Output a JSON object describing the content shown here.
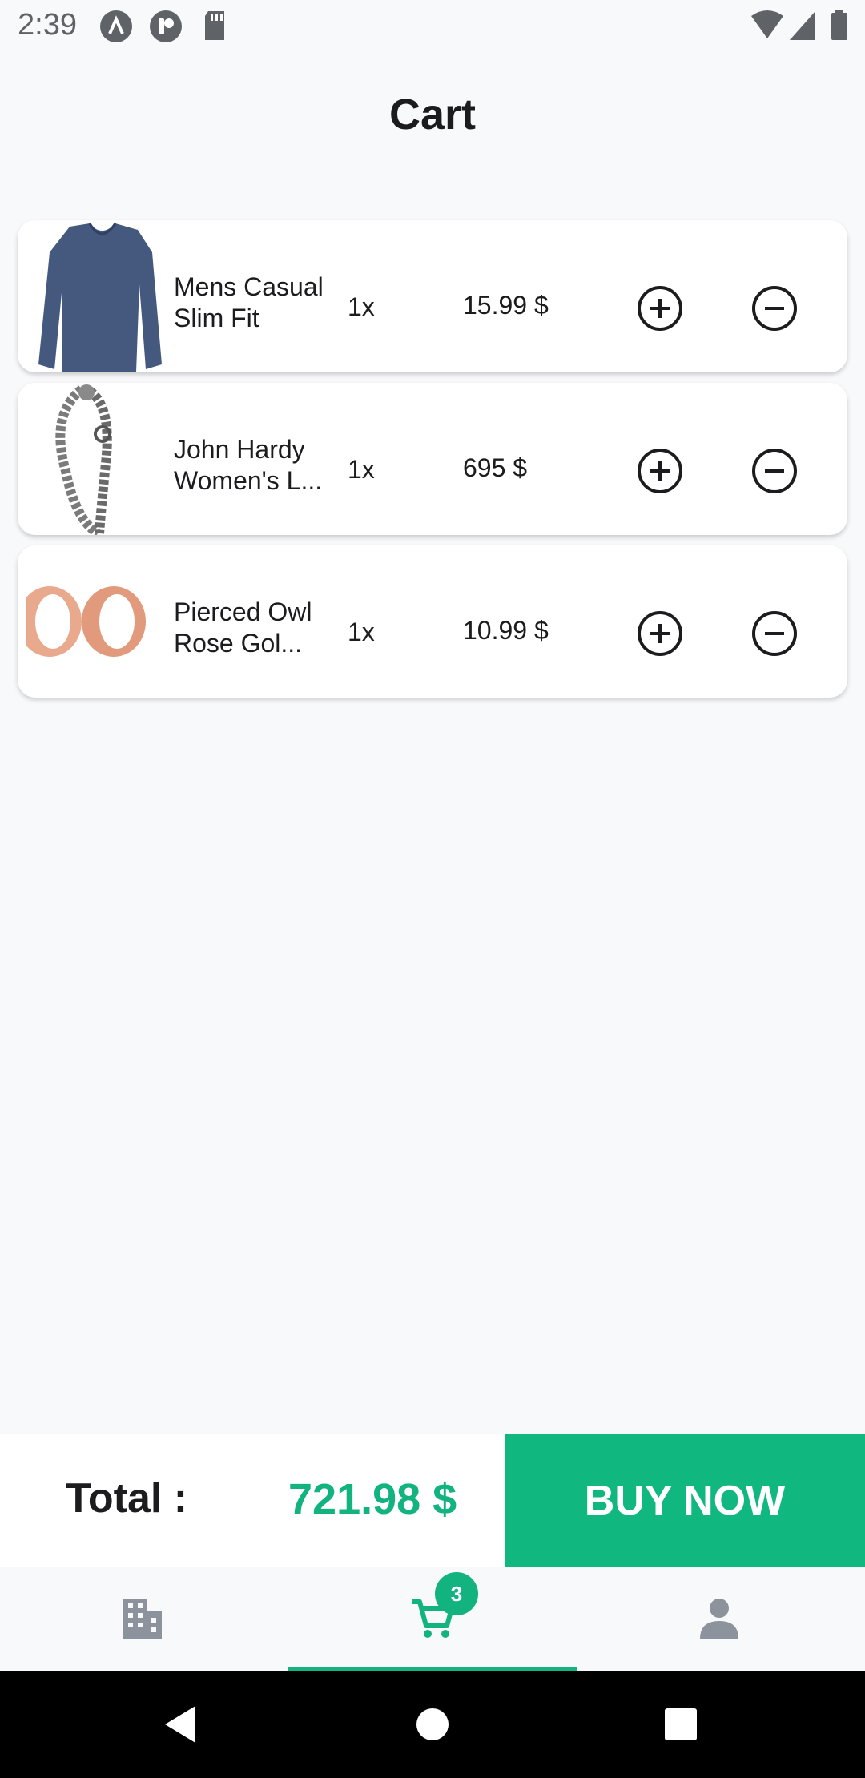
{
  "status_bar": {
    "time": "2:39"
  },
  "page": {
    "title": "Cart"
  },
  "cart": {
    "items": [
      {
        "name_line1": "Mens Casual",
        "name_line2": "Slim Fit",
        "quantity": "1x",
        "price": "15.99 $"
      },
      {
        "name_line1": "John Hardy",
        "name_line2": "Women's L...",
        "quantity": "1x",
        "price": "695 $"
      },
      {
        "name_line1": "Pierced Owl",
        "name_line2": "Rose Gol...",
        "quantity": "1x",
        "price": "10.99 $"
      }
    ]
  },
  "footer": {
    "total_label": "Total :",
    "total_value": "721.98 $",
    "buy_label": "BUY NOW"
  },
  "tabs": {
    "cart_badge": "3",
    "active": "cart"
  },
  "icons": [
    "shirt-thumbnail",
    "bracelet-thumbnail",
    "rings-thumbnail",
    "plus-circle-icon",
    "minus-circle-icon",
    "building-icon",
    "cart-icon",
    "person-icon",
    "back-icon",
    "home-icon",
    "recents-icon"
  ],
  "colors": {
    "accent": "#10b77f",
    "background": "#f8f9fb"
  }
}
